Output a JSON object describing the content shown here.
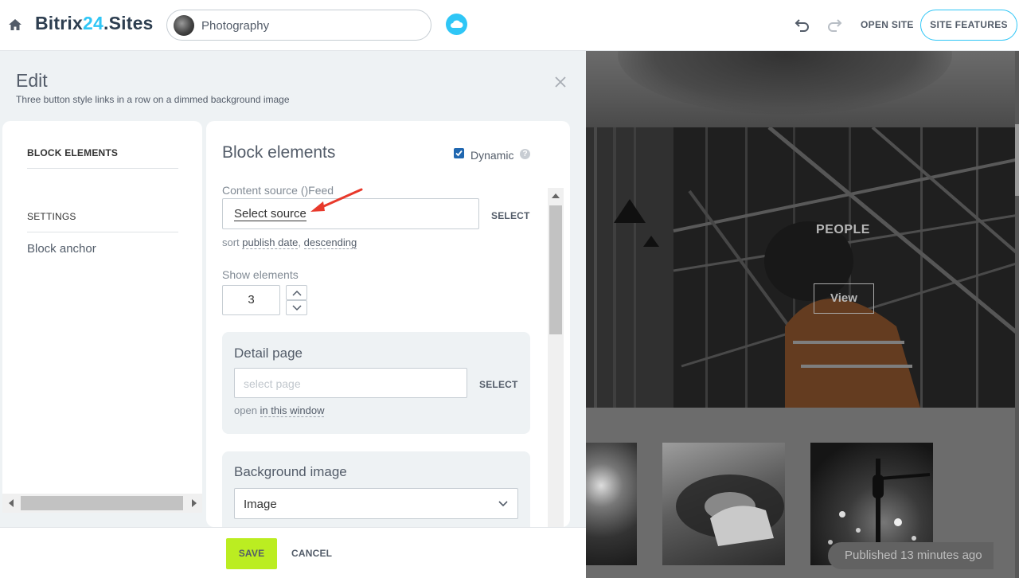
{
  "topbar": {
    "brand_name": "Bitrix",
    "brand_num": "24",
    "brand_suffix": ".Sites",
    "site_name": "Photography",
    "open_site": "OPEN SITE",
    "site_features": "SITE FEATURES"
  },
  "edit": {
    "title": "Edit",
    "subtitle": "Three button style links in a row on a dimmed background image"
  },
  "sidebar": {
    "block_elements": "BLOCK ELEMENTS",
    "settings": "SETTINGS",
    "block_anchor": "Block anchor"
  },
  "form": {
    "title": "Block elements",
    "dynamic_label": "Dynamic",
    "dynamic_checked": true,
    "help": "?",
    "content_source_label": "Content source ()Feed",
    "content_source_value": "Select source",
    "select_label": "SELECT",
    "sort_prefix": "sort",
    "sort_field": "publish date",
    "sort_sep": ",",
    "sort_order": "descending",
    "show_elements_label": "Show elements",
    "show_elements_value": "3",
    "detail_page_title": "Detail page",
    "detail_page_placeholder": "select page",
    "detail_select_label": "SELECT",
    "open_prefix": "open",
    "open_target": "in this window",
    "background_title": "Background image",
    "background_value": "Image"
  },
  "footer": {
    "save": "SAVE",
    "cancel": "CANCEL"
  },
  "preview": {
    "people": "PEOPLE",
    "view": "View",
    "published": "Published 13 minutes ago"
  },
  "colors": {
    "accent": "#2fc6f6",
    "save_green": "#bbed21",
    "annotation_arrow": "#e8392b",
    "checkbox": "#2067b0"
  }
}
